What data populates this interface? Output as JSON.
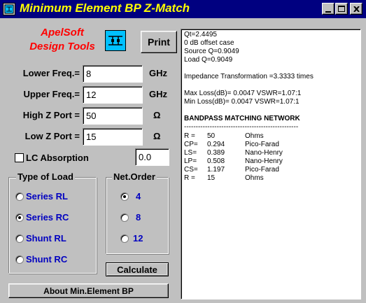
{
  "window": {
    "title": "Minimum Element BP Z-Match"
  },
  "logo": {
    "line1": "ApelSoft",
    "line2": "Design Tools"
  },
  "buttons": {
    "print": "Print",
    "calculate": "Calculate",
    "about": "About Min.Element BP"
  },
  "inputs": {
    "lower_freq": {
      "label": "Lower Freq.=",
      "value": "8",
      "unit": "GHz"
    },
    "upper_freq": {
      "label": "Upper Freq.=",
      "value": "12",
      "unit": "GHz"
    },
    "high_z": {
      "label": "High Z Port =",
      "value": "50",
      "unit": "Ω"
    },
    "low_z": {
      "label": "Low Z Port =",
      "value": "15",
      "unit": "Ω"
    }
  },
  "lc_absorption": {
    "label": "LC Absorption",
    "checked": false,
    "value": "0.0"
  },
  "load_type": {
    "title": "Type of Load",
    "options": [
      "Series RL",
      "Series RC",
      "Shunt RL",
      "Shunt RC"
    ],
    "selected": "Series RC"
  },
  "net_order": {
    "title": "Net.Order",
    "options": [
      "4",
      "8",
      "12"
    ],
    "selected": "4"
  },
  "results": {
    "lines": [
      "Qt=2.4495",
      "0 dB offset case",
      "Source Q=0.9049",
      "Load  Q=0.9049",
      "",
      "Impedance Transformation =3.3333 times",
      "",
      "Max Loss(dB)= 0.0047      VSWR=1.07:1",
      "Min Loss(dB)=  0.0047     VSWR=1.07:1",
      "",
      " BANDPASS MATCHING NETWORK",
      "-------------------------------------------------"
    ],
    "network": [
      {
        "name": "R =",
        "value": "50",
        "unit": "Ohms"
      },
      {
        "name": "CP=",
        "value": "0.294",
        "unit": "Pico-Farad"
      },
      {
        "name": "LS=",
        "value": "0.389",
        "unit": "Nano-Henry"
      },
      {
        "name": "LP=",
        "value": "0.508",
        "unit": "Nano-Henry"
      },
      {
        "name": "CS=",
        "value": "1.197",
        "unit": "Pico-Farad"
      },
      {
        "name": "R =",
        "value": "15",
        "unit": "Ohms"
      }
    ]
  }
}
